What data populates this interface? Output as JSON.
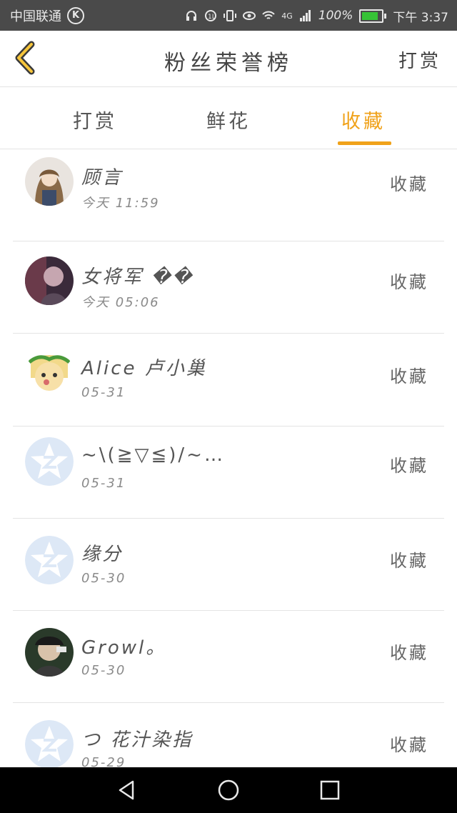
{
  "status_bar": {
    "carrier": "中国联通",
    "battery": "100%",
    "time": "下午 3:37",
    "network": "4G"
  },
  "header": {
    "title": "粉丝荣誉榜",
    "reward_label": "打赏"
  },
  "tabs": [
    {
      "label": "打赏"
    },
    {
      "label": "鲜花"
    },
    {
      "label": "收藏"
    }
  ],
  "active_tab": "收藏",
  "rows": [
    {
      "name": "顾言",
      "time": "今天 11:59",
      "action": "收藏",
      "avatar": "anime-girl-avatar"
    },
    {
      "name": "女将军 ��",
      "time": "今天 05:06",
      "action": "收藏",
      "avatar": "photo-avatar"
    },
    {
      "name": "Alice 卢小巢",
      "time": "05-31",
      "action": "收藏",
      "avatar": "cartoon-avatar"
    },
    {
      "name": "~\\(≧▽≦)/~…",
      "time": "05-31",
      "action": "收藏",
      "avatar": "default-qzone-avatar"
    },
    {
      "name": "缘分",
      "time": "05-30",
      "action": "收藏",
      "avatar": "default-qzone-avatar"
    },
    {
      "name": "Growl。",
      "time": "05-30",
      "action": "收藏",
      "avatar": "photo-avatar"
    },
    {
      "name": "つ 花汁染指",
      "time": "05-29",
      "action": "收藏",
      "avatar": "default-qzone-avatar"
    }
  ],
  "colors": {
    "accent": "#f0a21a",
    "status_bar": "#4a4a4a",
    "nav_bar": "#000000"
  }
}
